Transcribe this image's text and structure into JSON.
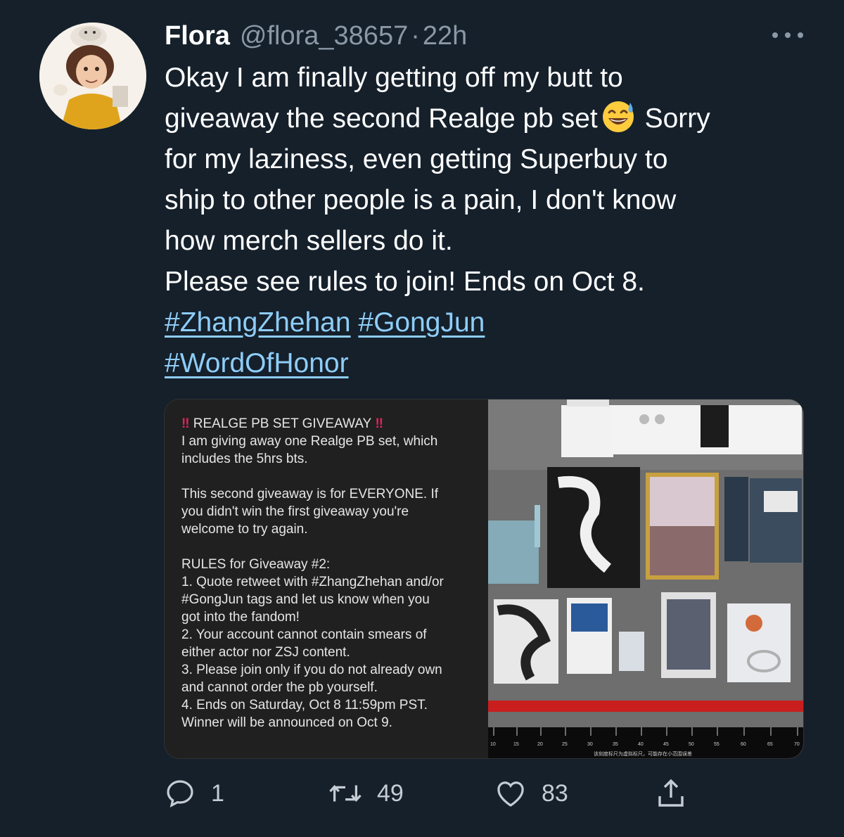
{
  "tweet": {
    "author_name": "Flora",
    "handle": "@flora_38657",
    "separator": "·",
    "time": "22h",
    "lines": [
      "Okay I am finally getting off my butt to",
      "giveaway the second Realge pb set",
      "Sorry",
      "for my laziness, even getting Superbuy to",
      "ship to other people is a pain, I don't know",
      "how merch sellers do it.",
      "Please see rules to join! Ends on Oct 8."
    ],
    "hashtags": [
      "#ZhangZhehan",
      "#GongJun",
      "#WordOfHonor"
    ],
    "emoji": "grinning-face-with-sweat"
  },
  "media": {
    "rules_title": "REALGE PB SET GIVEAWAY",
    "rules_paragraphs": [
      [
        "I am giving away one Realge PB set, which",
        "includes the 5hrs bts."
      ],
      [
        "This second giveaway is for EVERYONE. If",
        "you didn't win the first giveaway you're",
        "welcome to try again."
      ],
      [
        "RULES for Giveaway #2:",
        "1. Quote retweet with #ZhangZhehan and/or",
        "#GongJun tags and let us know when you",
        "got into the fandom!",
        "2. Your account cannot contain smears of",
        "either actor nor ZSJ content.",
        "3. Please join only if you do not already own",
        "and cannot order the pb yourself.",
        "4. Ends on Saturday, Oct 8 11:59pm PST.",
        "Winner will be announced on Oct 9."
      ]
    ],
    "ruler_numbers": [
      "10",
      "15",
      "20",
      "25",
      "30",
      "35",
      "40",
      "45",
      "50",
      "55",
      "60",
      "65",
      "70"
    ],
    "ruler_caption": "该刻度标尺为虚拟标尺，可能存在小范围误差"
  },
  "actions": {
    "reply_count": "1",
    "retweet_count": "49",
    "like_count": "83"
  },
  "colors": {
    "background": "#15202b",
    "link": "#8ecdf8",
    "muted": "#8b98a5"
  }
}
